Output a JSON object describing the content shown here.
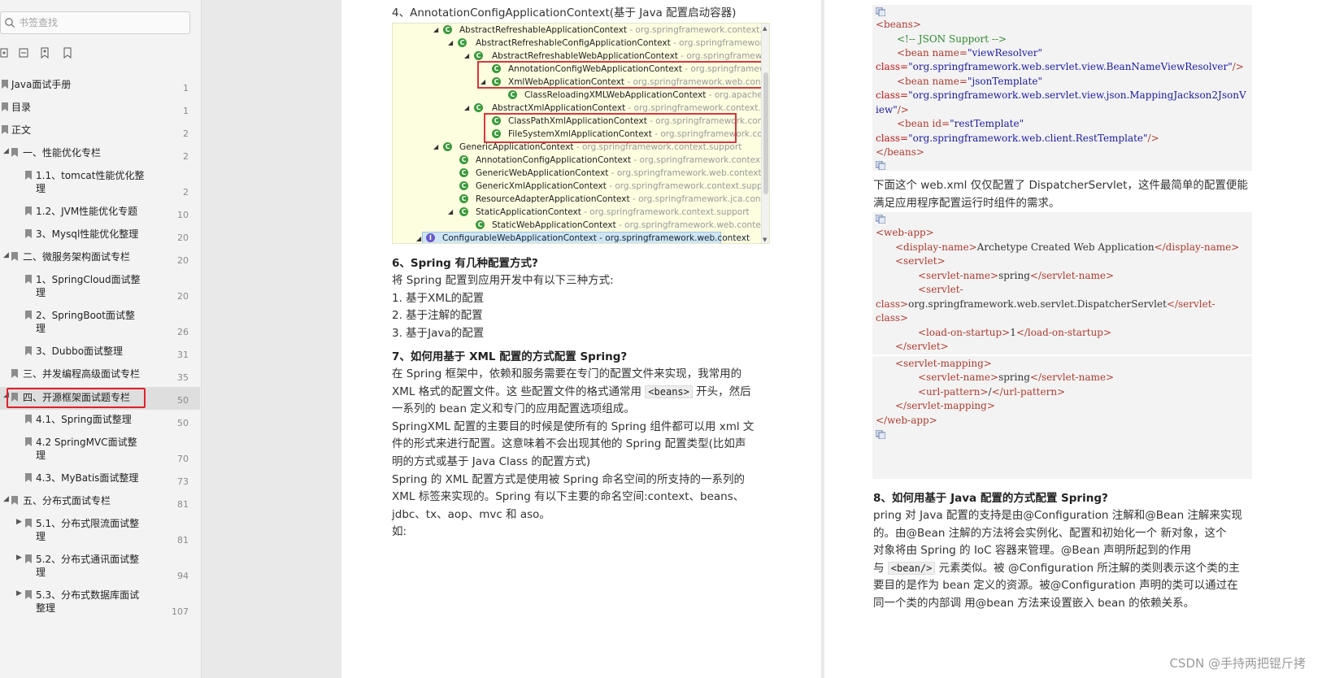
{
  "sidebar": {
    "search_placeholder": "书签查找",
    "toc": [
      {
        "label": "Java面试手册",
        "page": "1"
      },
      {
        "label": "目录",
        "page": "1"
      },
      {
        "label": "正文",
        "page": "2"
      },
      {
        "label": "一、性能优化专栏",
        "page": "2"
      },
      {
        "label": "1.1、tomcat性能优化整",
        "label2": "理",
        "page": "2"
      },
      {
        "label": "1.2、JVM性能优化专题",
        "page": "10"
      },
      {
        "label": "3、Mysql性能优化整理",
        "page": "20"
      },
      {
        "label": "二、微服务架构面试专栏",
        "page": "20"
      },
      {
        "label": "1、SpringCloud面试整",
        "label2": "理",
        "page": "20"
      },
      {
        "label": "2、SpringBoot面试整",
        "label2": "理",
        "page": "26"
      },
      {
        "label": "3、Dubbo面试整理",
        "page": "31"
      },
      {
        "label": "三、并发编程高级面试专栏",
        "page": "35"
      },
      {
        "label": "四、开源框架面试题专栏",
        "page": "50"
      },
      {
        "label": "4.1、Spring面试整理",
        "page": "50"
      },
      {
        "label": "4.2 SpringMVC面试整",
        "label2": "理",
        "page": "70"
      },
      {
        "label": "4.3、MyBatis面试整理",
        "page": "73"
      },
      {
        "label": "五、分布式面试专栏",
        "page": "81"
      },
      {
        "label": "5.1、分布式限流面试整",
        "label2": "理",
        "page": "81"
      },
      {
        "label": "5.2、分布式通讯面试整",
        "label2": "理",
        "page": "94"
      },
      {
        "label": "5.3、分布式数据库面试",
        "label2": "整理",
        "page": "107"
      }
    ]
  },
  "page1": {
    "heading4": "4、AnnotationConfigApplicationContext(基于 Java 配置启动容器)",
    "tree": [
      {
        "name": "AbstractRefreshableApplicationContext",
        "pkg": " - org.springframework.context.support"
      },
      {
        "name": "AbstractRefreshableConfigApplicationContext",
        "pkg": " - org.springframework.conte"
      },
      {
        "name": "AbstractRefreshableWebApplicationContext",
        "pkg": " - org.springframework.wel"
      },
      {
        "name": "AnnotationConfigWebApplicationContext",
        "pkg": " - org.springframework.w"
      },
      {
        "name": "XmlWebApplicationContext",
        "pkg": " - org.springframework.web.context.sup"
      },
      {
        "name": "ClassReloadingXMLWebApplicationContext",
        "pkg": " - org.apache.strut"
      },
      {
        "name": "AbstractXmlApplicationContext",
        "pkg": " - org.springframework.context.support"
      },
      {
        "name": "ClassPathXmlApplicationContext",
        "pkg": " - org.springframework.context.sup"
      },
      {
        "name": "FileSystemXmlApplicationContext",
        "pkg": " - org.springframework.context.su"
      },
      {
        "name": "GenericApplicationContext",
        "pkg": " - org.springframework.context.support"
      },
      {
        "name": "AnnotationConfigApplicationContext",
        "pkg": " - org.springframework.context.annota"
      },
      {
        "name": "GenericWebApplicationContext",
        "pkg": " - org.springframework.web.context.support"
      },
      {
        "name": "GenericXmlApplicationContext",
        "pkg": " - org.springframework.context.support"
      },
      {
        "name": "ResourceAdapterApplicationContext",
        "pkg": " - org.springframework.jca.context"
      },
      {
        "name": "StaticApplicationContext",
        "pkg": " - org.springframework.context.support"
      },
      {
        "name": "StaticWebApplicationContext",
        "pkg": " - org.springframework.web.context.suppo"
      },
      {
        "name": "ConfigurableWebApplicationContext",
        "pkg": " - org.springframework.web.context"
      }
    ],
    "q6_title": "6、Spring 有几种配置方式?",
    "q6_intro": "将 Spring 配置到应用开发中有以下三种方式:",
    "q6_items": [
      "1. 基于XML的配置",
      "2. 基于注解的配置",
      "3. 基于Java的配置"
    ],
    "q7_title": "7、如何用基于 XML 配置的方式配置 Spring?",
    "q7_l1": "在 Spring 框架中，依赖和服务需要在专门的配置文件来实现，我常用的",
    "q7_l2a": "XML 格式的配置文件。这 些配置文件的格式通常用 ",
    "q7_l2code": "<beans>",
    "q7_l2b": " 开头，然后",
    "q7_l3": "一系列的 bean 定义和专门的应用配置选项组成。",
    "q7_l4": "SpringXML 配置的主要目的时候是使所有的 Spring 组件都可以用 xml 文",
    "q7_l5": "件的形式来进行配置。这意味着不会出现其他的 Spring 配置类型(比如声",
    "q7_l6": "明的方式或基于 Java Class 的配置方式)",
    "q7_l7": "Spring 的 XML 配置方式是使用被 Spring 命名空间的所支持的一系列的",
    "q7_l8": "XML 标签来实现的。Spring 有以下主要的命名空间:context、beans、",
    "q7_l9": "jdbc、tx、aop、mvc 和 aso。",
    "q7_l10": "如:"
  },
  "page2": {
    "code1": {
      "beans_open": "<beans>",
      "comment": "<!-- JSON Support -->",
      "bean1_a": "<bean name=",
      "bean1_v": "\"viewResolver\"",
      "class1_a": "class=",
      "class1_v": "\"org.springframework.web.servlet.view.BeanNameViewResolver\"",
      "class1_end": "/>",
      "bean2_a": "<bean name=",
      "bean2_v": "\"jsonTemplate\"",
      "class2_a": "class=",
      "class2_v": "\"org.springframework.web.servlet.view.json.MappingJackson2JsonV",
      "class2_v2": "iew\"",
      "class2_end": "/>",
      "bean3_a": "<bean id=",
      "bean3_v": "\"restTemplate\"",
      "class3_a": "class=",
      "class3_v": "\"org.springframework.web.client.RestTemplate\"",
      "class3_end": "/>",
      "beans_close": "</beans>"
    },
    "para1_l1": "下面这个 web.xml 仅仅配置了 DispatcherServlet，这件最简单的配置便能",
    "para1_l2": "满足应用程序配置运行时组件的需求。",
    "code2": {
      "webapp_open": "<web-app>",
      "dn_open": "<display-name>",
      "dn_text": "Archetype Created Web Application",
      "dn_close": "</display-name>",
      "servlet_open": "<servlet>",
      "sn_open": "<servlet-name>",
      "sn_text": "spring",
      "sn_close": "</servlet-name>",
      "sc_open": "<servlet-",
      "sc_open2": "class>",
      "sc_text": "org.springframework.web.servlet.DispatcherServlet",
      "sc_close": "</servlet-",
      "sc_close2": "class>",
      "los_open": "<load-on-startup>",
      "los_text": "1",
      "los_close": "</load-on-startup>",
      "servlet_close": "</servlet>",
      "sm_open": "<servlet-mapping>",
      "sn2_open": "<servlet-name>",
      "sn2_text": "spring",
      "sn2_close": "</servlet-name>",
      "up_open": "<url-pattern>",
      "up_text": "/",
      "up_close": "</url-pattern>",
      "sm_close": "</servlet-mapping>",
      "webapp_close": "</web-app>"
    },
    "q8_title": "8、如何用基于 Java 配置的方式配置 Spring?",
    "q8_l1": "pring 对 Java 配置的支持是由@Configuration 注解和@Bean 注解来实现",
    "q8_l2": "的。由@Bean 注解的方法将会实例化、配置和初始化一个 新对象，这个",
    "q8_l3": "对象将由 Spring 的 IoC 容器来管理。@Bean 声明所起到的作用",
    "q8_l4a": "与 ",
    "q8_l4code": "<bean/>",
    "q8_l4b": " 元素类似。被 @Configuration 所注解的类则表示这个类的主",
    "q8_l5": "要目的是作为 bean 定义的资源。被@Configuration 声明的类可以通过在",
    "q8_l6": "同一个类的内部调 用@bean 方法来设置嵌入 bean 的依赖关系。"
  },
  "watermark": "CSDN @手持两把锟斤拷",
  "colors": {
    "selection_box": "#e0202a",
    "code_tag": "#b03a2e",
    "code_value": "#1a1aa6",
    "code_comment": "#2e8b2e"
  }
}
